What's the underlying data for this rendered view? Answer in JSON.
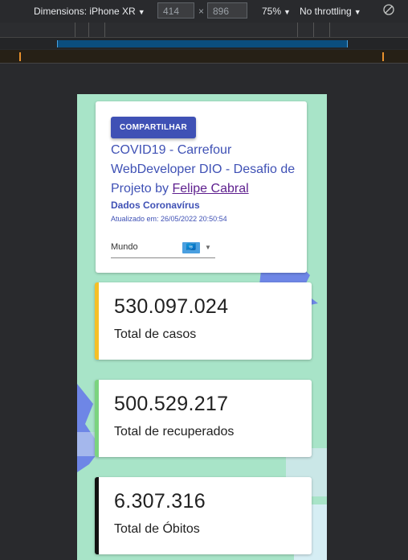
{
  "devtools": {
    "dimensions_label": "Dimensions: iPhone XR",
    "width_value": "414",
    "times": "×",
    "height_value": "896",
    "zoom": "75%",
    "throttling": "No throttling",
    "caret": "▼"
  },
  "app": {
    "share_label": "COMPARTILHAR",
    "title_text": "COVID19 - Carrefour WebDeveloper DIO - Desafio de Projeto by ",
    "title_link": "Felipe Cabral",
    "subtitle": "Dados Coronavírus",
    "updated": "Atualizado em: 26/05/2022 20:50:54",
    "select_value": "Mundo",
    "flag_glyph": "🇺🇳",
    "select_caret": "▼"
  },
  "stats": [
    {
      "value": "530.097.024",
      "label": "Total de casos",
      "color": "#f6bf26"
    },
    {
      "value": "500.529.217",
      "label": "Total de recuperados",
      "color": "#7bd47f"
    },
    {
      "value": "6.307.316",
      "label": "Total de Óbitos",
      "color": "#111111"
    }
  ],
  "colors": {
    "primary": "#3f51b5",
    "link": "#5e1f8e",
    "background": "#a8e4c8",
    "accent_shape": "#6e86e6"
  }
}
